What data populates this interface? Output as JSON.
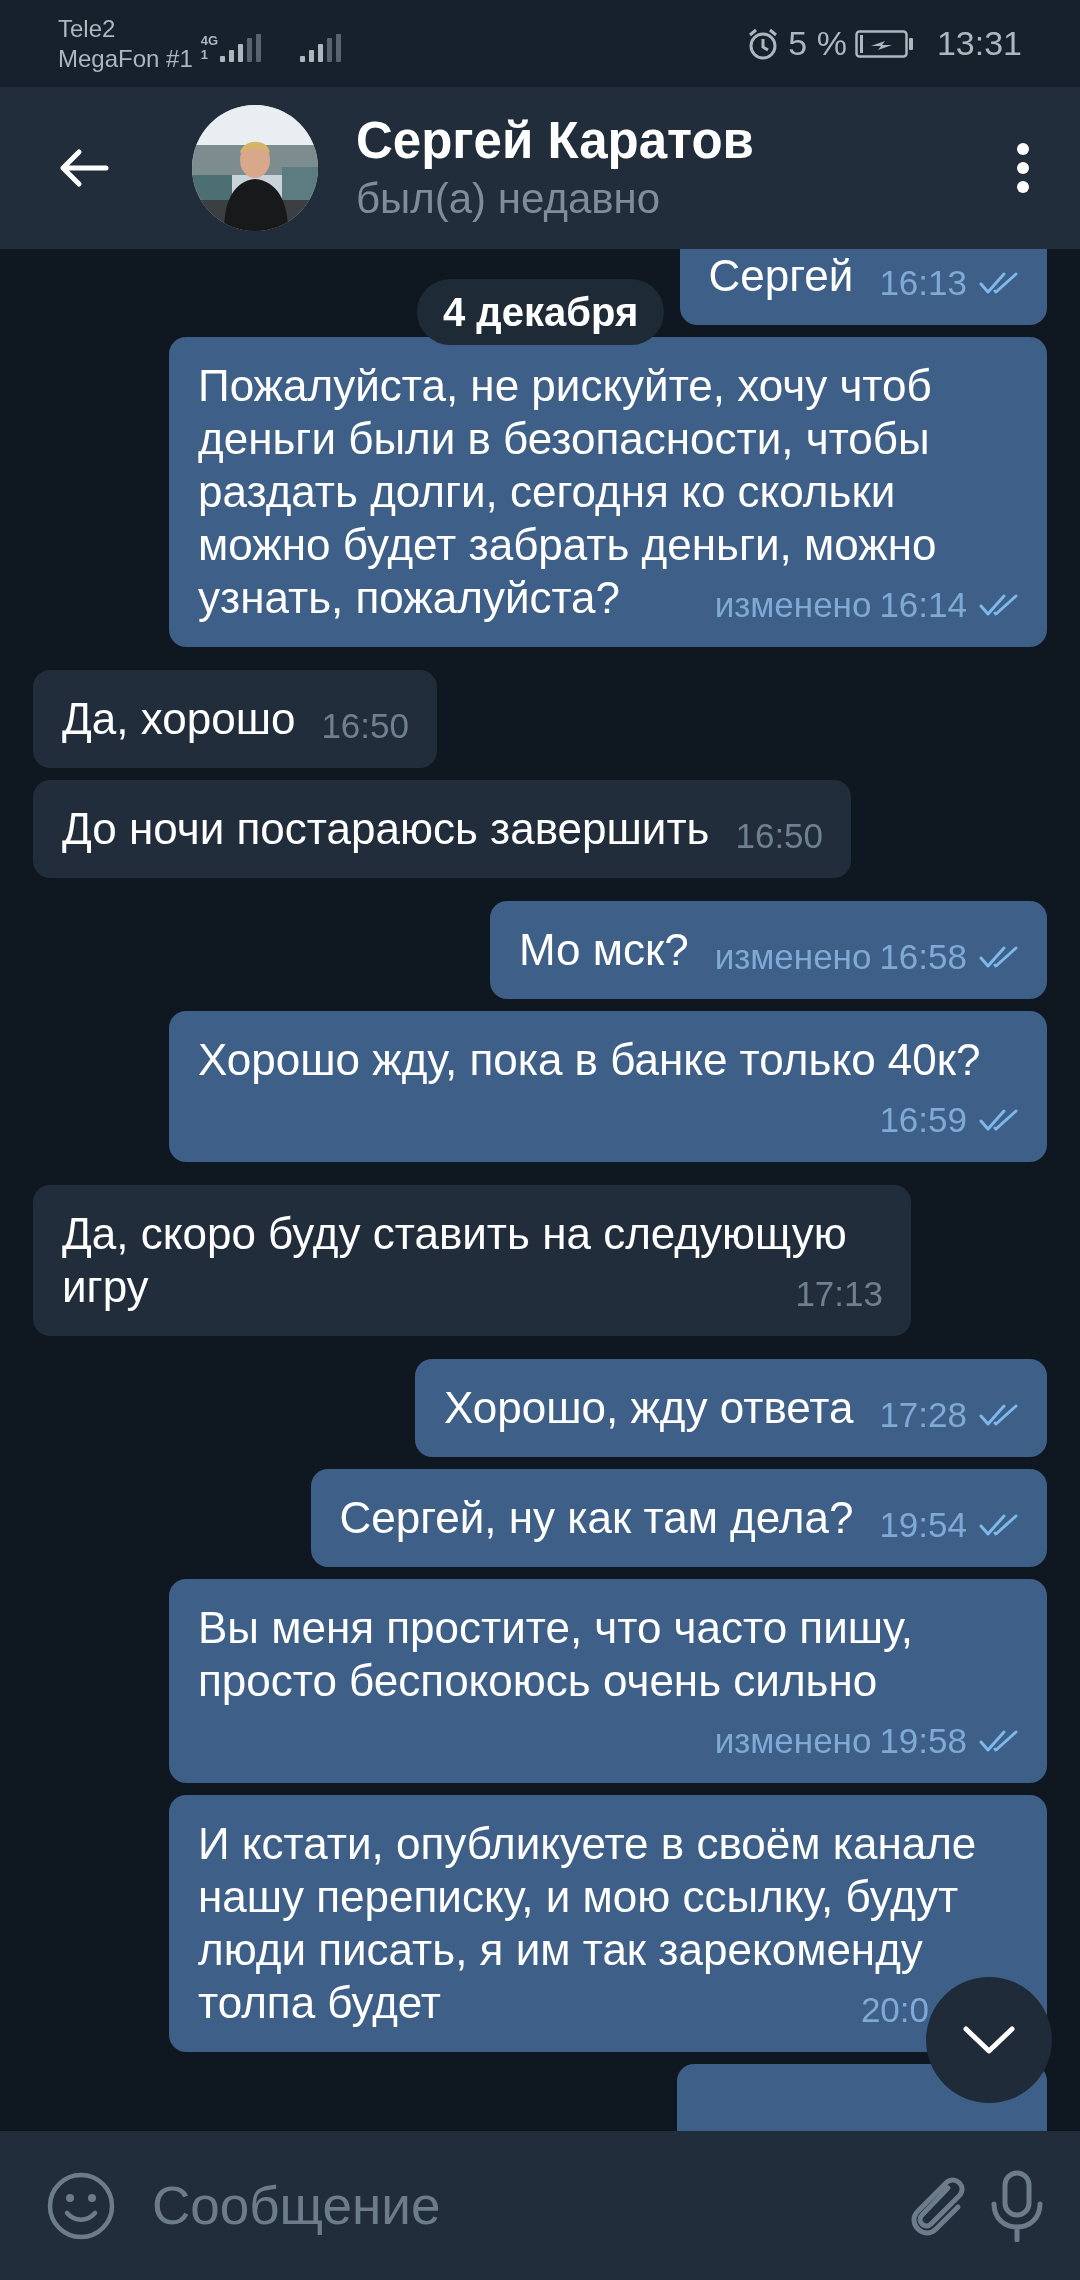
{
  "status_bar": {
    "carrier_1": "Tele2",
    "carrier_2": "MegaFon #1",
    "network": "4G",
    "sim": "1",
    "battery": "5 %",
    "time": "13:31"
  },
  "header": {
    "name": "Сергей Каратов",
    "status": "был(а) недавно"
  },
  "date_badge": "4 декабря",
  "messages": [
    {
      "kind": "outgoing",
      "text": "Сергей",
      "time": "16:13",
      "read": true
    },
    {
      "kind": "outgoing",
      "text": "Пожалуйста, не рискуйте, хочу чтоб деньги были в безопасности, чтобы раздать долги, сегодня ко скольки можно будет забрать деньги, можно узнать, пожалуйста?",
      "note": "изменено",
      "time": "16:14",
      "read": true
    },
    {
      "kind": "incoming",
      "text": "Да, хорошо",
      "time": "16:50"
    },
    {
      "kind": "incoming",
      "text": "До ночи постараюсь завершить",
      "time": "16:50"
    },
    {
      "kind": "outgoing",
      "text": "Мо мск?",
      "note": "изменено",
      "time": "16:58",
      "read": true
    },
    {
      "kind": "outgoing",
      "text": "Хорошо жду, пока в банке только 40к?",
      "time": "16:59",
      "read": true
    },
    {
      "kind": "incoming",
      "text": "Да, скоро буду ставить на следующую игру",
      "time": "17:13"
    },
    {
      "kind": "outgoing",
      "text": "Хорошо, жду ответа",
      "time": "17:28",
      "read": true
    },
    {
      "kind": "outgoing",
      "text": "Сергей, ну как там дела?",
      "time": "19:54",
      "read": true
    },
    {
      "kind": "outgoing",
      "text": "Вы меня простите, что часто пишу, просто беспокоюсь очень сильно",
      "note": "изменено",
      "time": "19:58",
      "read": true
    },
    {
      "kind": "outgoing",
      "text": "И кстати, опубликуете в своём канале нашу переписку, и мою ссылку, будут люди писать, я им так зарекоменду толпа будет",
      "time": "20:0"
    },
    {
      "kind": "outgoing"
    }
  ],
  "input": {
    "placeholder": "Сообщение"
  }
}
